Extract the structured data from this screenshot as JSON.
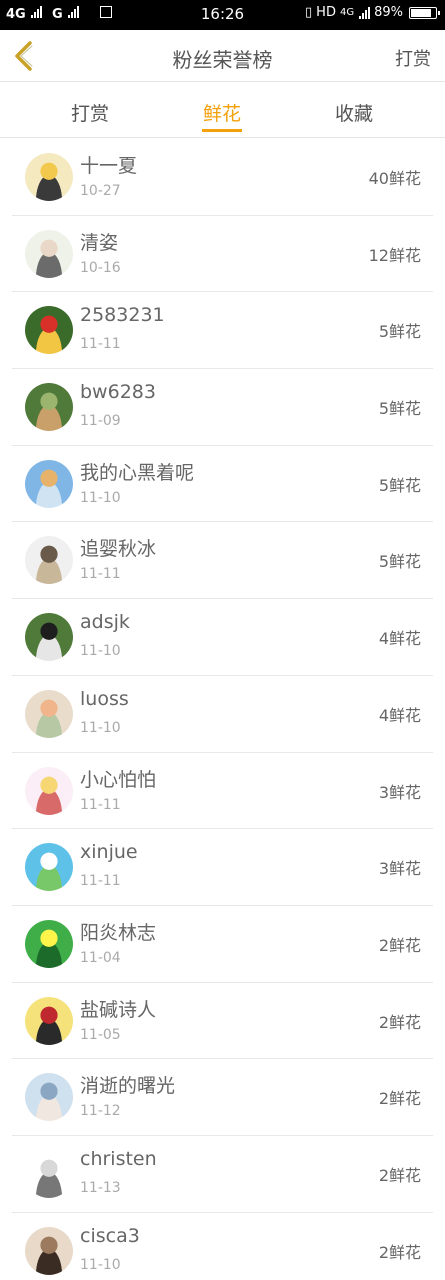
{
  "status_bar": {
    "sim1": "4G",
    "sim2": "G",
    "time": "16:26",
    "network": "HD",
    "net_type": "4G",
    "battery": "89%",
    "battery_level": 0.89
  },
  "header": {
    "title": "粉丝荣誉榜",
    "action": "打赏"
  },
  "tabs": [
    {
      "label": "打赏",
      "active": false
    },
    {
      "label": "鲜花",
      "active": true
    },
    {
      "label": "收藏",
      "active": false
    }
  ],
  "accent_color": "#f3a00a",
  "fans": [
    {
      "name": "十一夏",
      "date": "10-27",
      "count": "40鲜花",
      "avatar_colors": [
        "#f5e9c0",
        "#f2c94c",
        "#3a3a3a"
      ]
    },
    {
      "name": "清姿",
      "date": "10-16",
      "count": "12鲜花",
      "avatar_colors": [
        "#eef2e8",
        "#e9d8c8",
        "#6b6b6b"
      ]
    },
    {
      "name": "2583231",
      "date": "11-11",
      "count": "5鲜花",
      "avatar_colors": [
        "#3b6b2a",
        "#d8312a",
        "#f2c542"
      ]
    },
    {
      "name": "bw6283",
      "date": "11-09",
      "count": "5鲜花",
      "avatar_colors": [
        "#4f7a3a",
        "#9bb56e",
        "#c9a06a"
      ]
    },
    {
      "name": "我的心黑着呢",
      "date": "11-10",
      "count": "5鲜花",
      "avatar_colors": [
        "#7fb6e6",
        "#e7b36b",
        "#cfe3f3"
      ]
    },
    {
      "name": "追婴秋冰",
      "date": "11-11",
      "count": "5鲜花",
      "avatar_colors": [
        "#f0f0f0",
        "#6a5a4a",
        "#c9b79a"
      ]
    },
    {
      "name": "adsjk",
      "date": "11-10",
      "count": "4鲜花",
      "avatar_colors": [
        "#4f7a3a",
        "#1e1e1e",
        "#e6e6e6"
      ]
    },
    {
      "name": "luoss",
      "date": "11-10",
      "count": "4鲜花",
      "avatar_colors": [
        "#e9dccb",
        "#f0b58a",
        "#b7c8a5"
      ]
    },
    {
      "name": "小心怕怕",
      "date": "11-11",
      "count": "3鲜花",
      "avatar_colors": [
        "#fbeef6",
        "#f7d774",
        "#d86a6a"
      ]
    },
    {
      "name": "xinjue",
      "date": "11-11",
      "count": "3鲜花",
      "avatar_colors": [
        "#5ec1e8",
        "#ffffff",
        "#78c86a"
      ]
    },
    {
      "name": "阳炎林志",
      "date": "11-04",
      "count": "2鲜花",
      "avatar_colors": [
        "#3fae49",
        "#fff44a",
        "#1c6b2a"
      ]
    },
    {
      "name": "盐碱诗人",
      "date": "11-05",
      "count": "2鲜花",
      "avatar_colors": [
        "#f6e27a",
        "#c0282f",
        "#2a2a2a"
      ]
    },
    {
      "name": "消逝的曙光",
      "date": "11-12",
      "count": "2鲜花",
      "avatar_colors": [
        "#cfe0ee",
        "#8aa6c2",
        "#f0e8e0"
      ]
    },
    {
      "name": "christen",
      "date": "11-13",
      "count": "2鲜花",
      "avatar_colors": [
        "#ffffff",
        "#d8d8d8",
        "#777777"
      ]
    },
    {
      "name": "cisca3",
      "date": "11-10",
      "count": "2鲜花",
      "avatar_colors": [
        "#e9d9c8",
        "#9b7a5d",
        "#3a2c22"
      ]
    }
  ]
}
